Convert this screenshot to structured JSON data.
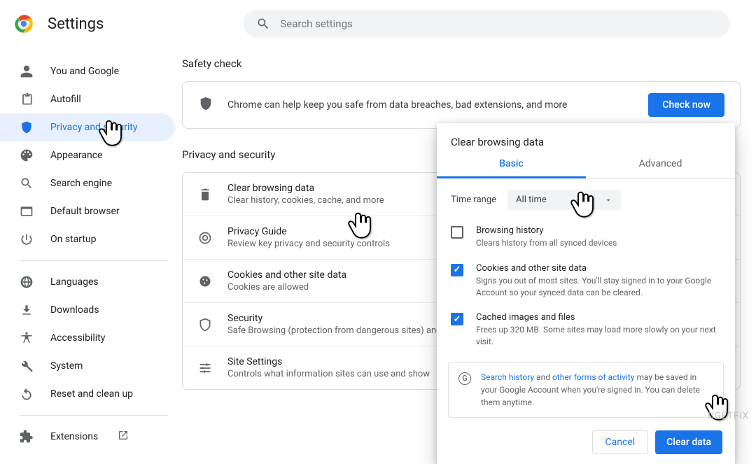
{
  "header": {
    "title": "Settings",
    "searchPlaceholder": "Search settings"
  },
  "sidebar": {
    "items": [
      {
        "label": "You and Google"
      },
      {
        "label": "Autofill"
      },
      {
        "label": "Privacy and security"
      },
      {
        "label": "Appearance"
      },
      {
        "label": "Search engine"
      },
      {
        "label": "Default browser"
      },
      {
        "label": "On startup"
      }
    ],
    "more": [
      {
        "label": "Languages"
      },
      {
        "label": "Downloads"
      },
      {
        "label": "Accessibility"
      },
      {
        "label": "System"
      },
      {
        "label": "Reset and clean up"
      }
    ],
    "extensions": "Extensions"
  },
  "safety": {
    "heading": "Safety check",
    "text": "Chrome can help keep you safe from data breaches, bad extensions, and more",
    "button": "Check now"
  },
  "privacy": {
    "heading": "Privacy and security",
    "rows": [
      {
        "title": "Clear browsing data",
        "sub": "Clear history, cookies, cache, and more"
      },
      {
        "title": "Privacy Guide",
        "sub": "Review key privacy and security controls"
      },
      {
        "title": "Cookies and other site data",
        "sub": "Cookies are allowed"
      },
      {
        "title": "Security",
        "sub": "Safe Browsing (protection from dangerous sites) and other security settings"
      },
      {
        "title": "Site Settings",
        "sub": "Controls what information sites can use and show"
      }
    ]
  },
  "dialog": {
    "title": "Clear browsing data",
    "tabs": {
      "basic": "Basic",
      "advanced": "Advanced"
    },
    "timeLabel": "Time range",
    "timeValue": "All time",
    "checks": [
      {
        "title": "Browsing history",
        "sub": "Clears history from all synced devices",
        "checked": false
      },
      {
        "title": "Cookies and other site data",
        "sub": "Signs you out of most sites. You'll stay signed in to your Google Account so your synced data can be cleared.",
        "checked": true
      },
      {
        "title": "Cached images and files",
        "sub": "Frees up 320 MB. Some sites may load more slowly on your next visit.",
        "checked": true
      }
    ],
    "notice": {
      "link1": "Search history",
      "mid": " and ",
      "link2": "other forms of activity",
      "rest": " may be saved in your Google Account when you're signed in. You can delete them anytime."
    },
    "cancel": "Cancel",
    "clear": "Clear data"
  },
  "watermark": "UGETFIX"
}
